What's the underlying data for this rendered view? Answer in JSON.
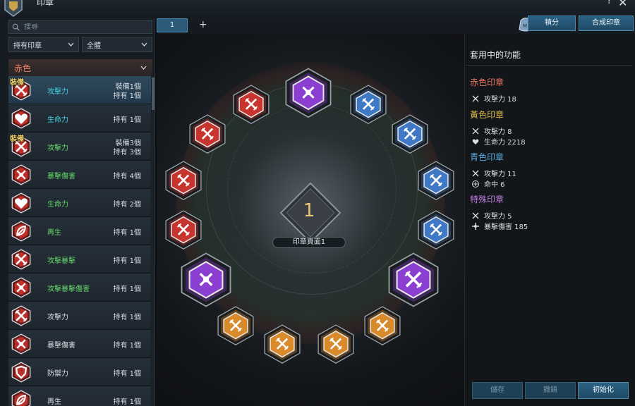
{
  "window": {
    "title": "印章",
    "help_label": "?",
    "close_label": "✕"
  },
  "left_panel": {
    "search_placeholder": "搜尋",
    "filter_owned": "持有印章",
    "filter_all": "全體",
    "category": "赤色",
    "equip_badge": "裝備",
    "items": [
      {
        "name": "攻擊力",
        "color": "cyan",
        "count": [
          "裝備1個",
          "持有 1個"
        ],
        "equipped": true,
        "icon": "sword-icon"
      },
      {
        "name": "生命力",
        "color": "cyan",
        "count": [
          "持有 1個"
        ],
        "equipped": false,
        "icon": "heart-icon"
      },
      {
        "name": "攻擊力",
        "color": "green",
        "count": [
          "裝備3個",
          "持有 3個"
        ],
        "equipped": true,
        "icon": "sword-icon"
      },
      {
        "name": "暴擊傷害",
        "color": "green",
        "count": [
          "持有 4個"
        ],
        "equipped": false,
        "icon": "crit-icon"
      },
      {
        "name": "生命力",
        "color": "green",
        "count": [
          "持有 2個"
        ],
        "equipped": false,
        "icon": "heart-icon"
      },
      {
        "name": "再生",
        "color": "green",
        "count": [
          "持有 1個"
        ],
        "equipped": false,
        "icon": "leaf-icon"
      },
      {
        "name": "攻擊暴擊",
        "color": "green",
        "count": [
          "持有 1個"
        ],
        "equipped": false,
        "icon": "sword-icon"
      },
      {
        "name": "攻擊暴擊傷害",
        "color": "green",
        "count": [
          "持有 1個"
        ],
        "equipped": false,
        "icon": "crit-icon"
      },
      {
        "name": "攻擊力",
        "color": "white",
        "count": [
          "持有 1個"
        ],
        "equipped": false,
        "icon": "sword-icon"
      },
      {
        "name": "暴擊傷害",
        "color": "white",
        "count": [
          "持有 1個"
        ],
        "equipped": false,
        "icon": "crit-icon"
      },
      {
        "name": "防禦力",
        "color": "white",
        "count": [
          "持有 1個"
        ],
        "equipped": false,
        "icon": "shield-icon"
      },
      {
        "name": "再生",
        "color": "white",
        "count": [
          "持有 1個"
        ],
        "equipped": false,
        "icon": "leaf-icon"
      }
    ]
  },
  "tabs": {
    "active": "1",
    "add_label": "+"
  },
  "top_buttons": {
    "points": "積分",
    "synthesize": "合成印章"
  },
  "board": {
    "page_number": "1",
    "page_label": "印章頁面1"
  },
  "applied": {
    "title": "套用中的功能",
    "sections": [
      {
        "title": "赤色印章",
        "color": "#e8745e",
        "stats": [
          {
            "icon": "sword-icon",
            "text": "攻擊力  18"
          }
        ]
      },
      {
        "title": "黃色印章",
        "color": "#e6c04e",
        "stats": [
          {
            "icon": "sword-icon",
            "text": "攻擊力  8"
          },
          {
            "icon": "heart-icon",
            "text": "生命力  2218"
          }
        ]
      },
      {
        "title": "青色印章",
        "color": "#5aa8e0",
        "stats": [
          {
            "icon": "sword-icon",
            "text": "攻擊力  11"
          },
          {
            "icon": "target-icon",
            "text": "命中  6"
          }
        ]
      },
      {
        "title": "特殊印章",
        "color": "#c07be0",
        "stats": [
          {
            "icon": "sword-icon",
            "text": "攻擊力  5"
          },
          {
            "icon": "crit-icon",
            "text": "暴擊傷害  185"
          }
        ]
      }
    ]
  },
  "bottom_buttons": {
    "save": "儲存",
    "undo": "撤銷",
    "reset": "初始化"
  },
  "colors": {
    "red": "#c8352e",
    "blue": "#3f78c4",
    "orange": "#d98a2b",
    "purple": "#8a3fd0",
    "accent": "#2b6182"
  }
}
